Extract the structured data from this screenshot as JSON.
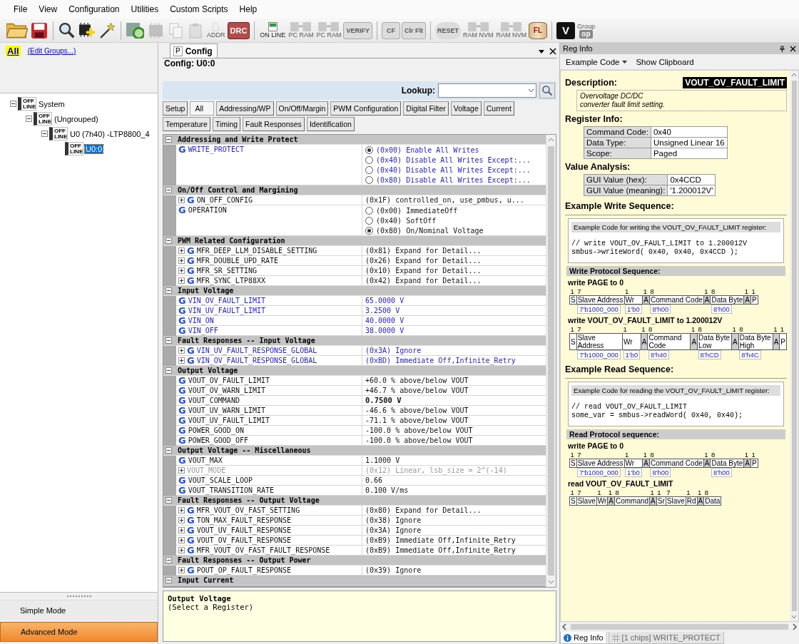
{
  "menu": [
    "File",
    "View",
    "Configuration",
    "Utilities",
    "Custom Scripts",
    "Help"
  ],
  "toolbar": [
    {
      "kind": "folder",
      "disabled": false
    },
    {
      "kind": "disk",
      "disabled": false
    },
    {
      "kind": "separator"
    },
    {
      "kind": "magnifier",
      "disabled": false
    },
    {
      "kind": "chip-plus",
      "disabled": false
    },
    {
      "kind": "wand",
      "disabled": false
    },
    {
      "kind": "separator"
    },
    {
      "kind": "chip-search",
      "disabled": false
    },
    {
      "kind": "chip",
      "disabled": true
    },
    {
      "kind": "pages",
      "disabled": true
    },
    {
      "kind": "clipboard",
      "disabled": true
    },
    {
      "kind": "document",
      "text": "ADDR",
      "disabled": true
    },
    {
      "kind": "red-badge",
      "text": "DRC",
      "disabled": false
    },
    {
      "kind": "separator"
    },
    {
      "kind": "online",
      "text": "ON LINE",
      "disabled": false
    },
    {
      "kind": "chip-arrow",
      "text": "PC RAM",
      "disabled": true
    },
    {
      "kind": "chip-arrow",
      "text": "PC RAM",
      "disabled": true
    },
    {
      "kind": "grey-badge",
      "text": "VERIFY",
      "disabled": true
    },
    {
      "kind": "separator"
    },
    {
      "kind": "grey-badge",
      "text": "CF",
      "disabled": true
    },
    {
      "kind": "grey-badge",
      "text": "Clr Flt",
      "disabled": true
    },
    {
      "kind": "separator"
    },
    {
      "kind": "round-badge",
      "text": "RESET",
      "disabled": true
    },
    {
      "kind": "chip-arrow",
      "text": "RAM NVM",
      "disabled": true
    },
    {
      "kind": "chip-arrow",
      "text": "RAM NVM",
      "disabled": true
    },
    {
      "kind": "cylinder",
      "text": "FL",
      "disabled": false
    },
    {
      "kind": "separator"
    },
    {
      "kind": "dark-badge",
      "text": "V",
      "disabled": false
    },
    {
      "kind": "group",
      "label": "Group",
      "text": "op",
      "disabled": true
    }
  ],
  "groups_panel": {
    "all_label": "All",
    "edit_link": "(Edit Groups...)"
  },
  "device_tree": [
    {
      "label": "System",
      "badge": "OFF LINE",
      "expanded": true,
      "selected": false,
      "children": [
        {
          "label": "(Ungrouped)",
          "badge": "OFF LINE",
          "expanded": true,
          "selected": false,
          "children": [
            {
              "label": "U0 (7h40) -LTP8800_4",
              "badge": "OFF LINE",
              "expanded": true,
              "selected": false,
              "children": [
                {
                  "label": "U0:0",
                  "badge": "OFF LINE",
                  "selected": true
                }
              ]
            }
          ]
        }
      ]
    }
  ],
  "mode_buttons": [
    {
      "label": "Simple Mode",
      "selected": false
    },
    {
      "label": "Advanced Mode",
      "selected": true
    }
  ],
  "config_panel": {
    "tabs": [
      {
        "pin": "P",
        "label": "Config",
        "selected": true
      }
    ],
    "title": "Config: U0:0",
    "lookup": {
      "label": "Lookup:"
    },
    "filters": [
      {
        "label": "Setup",
        "selected": false
      },
      {
        "label": "All",
        "selected": true
      },
      {
        "label": "Addressing/WP",
        "selected": false
      },
      {
        "label": "On/Off/Margin",
        "selected": false
      },
      {
        "label": "PWM Configuration",
        "selected": false
      },
      {
        "label": "Digital Filter",
        "selected": false
      },
      {
        "label": "Voltage",
        "selected": false
      },
      {
        "label": "Current",
        "selected": false
      },
      {
        "label": "Temperature",
        "selected": false
      },
      {
        "label": "Timing",
        "selected": false
      },
      {
        "label": "Fault Responses",
        "selected": false
      },
      {
        "label": "Identification",
        "selected": false
      }
    ],
    "groups": [
      {
        "title": "Addressing and Write Protect",
        "expanded": true,
        "rows": [
          {
            "kind": "options",
            "badge": "G",
            "name": "WRITE_PROTECT",
            "modified": true,
            "options": [
              {
                "label": "(0x00) Enable All Writes",
                "selected": true
              },
              {
                "label": "(0x40) Disable All Writes Except:...",
                "selected": false
              },
              {
                "label": "(0x40) Disable All Writes Except:...",
                "selected": false
              },
              {
                "label": "(0x80) Disable All Writes Except:...",
                "selected": false
              }
            ]
          }
        ]
      },
      {
        "title": "On/Off Control and Margining",
        "expanded": true,
        "rows": [
          {
            "kind": "expandable",
            "badge": "G",
            "name": "ON_OFF_CONFIG",
            "modified": false,
            "value": "(0x1F)  controlled_on, use_pmbus, u..."
          },
          {
            "kind": "options",
            "badge": "G",
            "name": "OPERATION",
            "modified": false,
            "options": [
              {
                "label": "(0x00) ImmediateOff",
                "selected": false
              },
              {
                "label": "(0x40) SoftOff",
                "selected": false
              },
              {
                "label": "(0x80) On/Nominal Voltage",
                "selected": true
              }
            ]
          }
        ]
      },
      {
        "title": "PWM Related Configuration",
        "expanded": true,
        "rows": [
          {
            "kind": "expandable",
            "badge": "G",
            "name": "MFR_DEEP_LLM_DISABLE_SETTING",
            "modified": false,
            "value": "(0x81) Expand for Detail..."
          },
          {
            "kind": "expandable",
            "badge": "G",
            "name": "MFR_DOUBLE_UPD_RATE",
            "modified": false,
            "value": "(0x26) Expand for Detail..."
          },
          {
            "kind": "expandable",
            "badge": "G",
            "name": "MFR_SR_SETTING",
            "modified": false,
            "value": "(0x10) Expand for Detail..."
          },
          {
            "kind": "expandable",
            "badge": "G",
            "name": "MFR_SYNC_LTP88XX",
            "modified": false,
            "value": "(0x42) Expand for Detail..."
          }
        ]
      },
      {
        "title": "Input Voltage",
        "expanded": true,
        "rows": [
          {
            "kind": "value",
            "badge": "G",
            "name": "VIN_OV_FAULT_LIMIT",
            "modified": true,
            "value": "65.0000 V"
          },
          {
            "kind": "value",
            "badge": "G",
            "name": "VIN_UV_FAULT_LIMIT",
            "modified": true,
            "value": "3.2500 V"
          },
          {
            "kind": "value",
            "badge": "G",
            "name": "VIN_ON",
            "modified": true,
            "value": "40.0000 V"
          },
          {
            "kind": "value",
            "badge": "G",
            "name": "VIN_OFF",
            "modified": true,
            "value": "38.0000 V"
          }
        ]
      },
      {
        "title": "Fault Responses -- Input Voltage",
        "expanded": true,
        "rows": [
          {
            "kind": "expandable",
            "badge": "G",
            "name": "VIN_UV_FAULT_RESPONSE_GLOBAL",
            "modified": true,
            "value": "(0x3A) Ignore"
          },
          {
            "kind": "expandable",
            "badge": "G",
            "name": "VIN_OV_FAULT_RESPONSE_GLOBAL",
            "modified": true,
            "value": "(0xBD) Immediate Off,Infinite_Retry"
          }
        ]
      },
      {
        "title": "Output Voltage",
        "expanded": true,
        "rows": [
          {
            "kind": "value",
            "badge": "G",
            "name": "VOUT_OV_FAULT_LIMIT",
            "modified": false,
            "value": "+60.0 % above/below VOUT"
          },
          {
            "kind": "value",
            "badge": "G",
            "name": "VOUT_OV_WARN_LIMIT",
            "modified": false,
            "value": "+46.7 % above/below VOUT"
          },
          {
            "kind": "emphasized",
            "badge": "G",
            "name": "VOUT_COMMAND",
            "modified": false,
            "value": "0.7500 V"
          },
          {
            "kind": "value",
            "badge": "G",
            "name": "VOUT_UV_WARN_LIMIT",
            "modified": false,
            "value": "-46.6 % above/below VOUT"
          },
          {
            "kind": "value",
            "badge": "G",
            "name": "VOUT_UV_FAULT_LIMIT",
            "modified": false,
            "value": "-71.1 % above/below VOUT"
          },
          {
            "kind": "value",
            "badge": "G",
            "name": "POWER_GOOD_ON",
            "modified": false,
            "value": "-100.0 % above/below VOUT"
          },
          {
            "kind": "value",
            "badge": "G",
            "name": "POWER_GOOD_OFF",
            "modified": false,
            "value": "-100.0 % above/below VOUT"
          }
        ]
      },
      {
        "title": "Output Voltage -- Miscellaneous",
        "expanded": true,
        "rows": [
          {
            "kind": "value",
            "badge": "G",
            "name": "VOUT_MAX",
            "modified": false,
            "value": "1.1000 V"
          },
          {
            "kind": "readonly",
            "name": "VOUT_MODE",
            "modified": false,
            "value": "(0x12) Linear, lsb_size = 2^(-14)"
          },
          {
            "kind": "value",
            "badge": "G",
            "name": "VOUT_SCALE_LOOP",
            "modified": false,
            "value": "0.66"
          },
          {
            "kind": "value",
            "badge": "G",
            "name": "VOUT_TRANSITION_RATE",
            "modified": false,
            "value": "0.100 V/ms"
          }
        ]
      },
      {
        "title": "Fault Responses -- Output Voltage",
        "expanded": true,
        "rows": [
          {
            "kind": "expandable",
            "badge": "G",
            "name": "MFR_VOUT_OV_FAST_SETTING",
            "modified": false,
            "value": "(0x80) Expand for Detail..."
          },
          {
            "kind": "expandable",
            "badge": "G",
            "name": "TON_MAX_FAULT_RESPONSE",
            "modified": false,
            "value": "(0x38) Ignore"
          },
          {
            "kind": "expandable",
            "badge": "G",
            "name": "VOUT_UV_FAULT_RESPONSE",
            "modified": false,
            "value": "(0x3A) Ignore"
          },
          {
            "kind": "expandable",
            "badge": "G",
            "name": "VOUT_OV_FAULT_RESPONSE",
            "modified": false,
            "value": "(0xB9) Immediate Off,Infinite_Retry"
          },
          {
            "kind": "expandable",
            "badge": "G",
            "name": "MFR_VOUT_OV_FAST_FAULT_RESPONSE",
            "modified": false,
            "value": "(0xB9) Immediate Off,Infinite_Retry"
          }
        ]
      },
      {
        "title": "Fault Responses -- Output Power",
        "expanded": true,
        "rows": [
          {
            "kind": "expandable",
            "badge": "G",
            "name": "POUT_OP_FAULT_RESPONSE",
            "modified": false,
            "value": "(0x39) Ignore"
          }
        ]
      },
      {
        "title": "Input Current",
        "expanded": true
      }
    ],
    "description": {
      "title": "Output Voltage",
      "text": "(Select a Register)"
    }
  },
  "reg_info": {
    "title": "Reg Info",
    "toolbar": [
      {
        "label": "Example Code",
        "dropdown": true
      },
      {
        "label": "Show Clipboard",
        "dropdown": false
      }
    ],
    "description": {
      "label": "Description:",
      "register": "VOUT_OV_FAULT_LIMIT",
      "lines": [
        "Overvoltage DC/DC",
        "converter fault limit setting."
      ]
    },
    "register_info": {
      "heading": "Register Info:",
      "rows": [
        {
          "label": "Command Code:",
          "value": "0x40"
        },
        {
          "label": "Data Type:",
          "value": "Unsigned Linear 16"
        },
        {
          "label": "Scope:",
          "value": "Paged"
        }
      ]
    },
    "value_analysis": {
      "heading": "Value Analysis:",
      "rows": [
        {
          "label": "GUI Value (hex):",
          "value": "0x4CCD"
        },
        {
          "label": "GUI Value (meaning):",
          "value": "'1.200012V'"
        }
      ]
    },
    "sequences": [
      {
        "heading": "Example Write Sequence:",
        "code_caption": "Example Code for writing the VOUT_OV_FAULT_LIMIT register:",
        "code": [
          "// write VOUT_OV_FAULT_LIMIT to 1.200012V",
          "smbus->writeWord( 0x40, 0x40, 0x4CCD );"
        ],
        "protocol_heading": "Write Protocol Sequence:",
        "frames": [
          {
            "title": "write PAGE to 0",
            "fields": [
              {
                "bits": "1",
                "label": "S",
                "kind": "plain"
              },
              {
                "bits": "7",
                "label": "Slave Address",
                "kind": "plain",
                "value": "7'b1000_000"
              },
              {
                "bits": "1",
                "label": "Wr",
                "kind": "plain",
                "value": "1'b0"
              },
              {
                "bits": "1",
                "label": "A",
                "kind": "ack"
              },
              {
                "bits": "8",
                "label": "Command Code",
                "kind": "plain",
                "value": "8'h00"
              },
              {
                "bits": "1",
                "label": "A",
                "kind": "ack"
              },
              {
                "bits": "8",
                "label": "Data Byte",
                "kind": "plain",
                "value": "8'h00"
              },
              {
                "bits": "1",
                "label": "A",
                "kind": "ack"
              },
              {
                "bits": "1",
                "label": "P",
                "kind": "plain"
              }
            ]
          },
          {
            "title": "write VOUT_OV_FAULT_LIMIT to 1.200012V",
            "fields": [
              {
                "bits": "1",
                "label": "S",
                "kind": "plain"
              },
              {
                "bits": "7",
                "label": "Slave Address",
                "kind": "plain",
                "value": "7'b1000_000"
              },
              {
                "bits": "1",
                "label": "Wr",
                "kind": "plain",
                "value": "1'b0"
              },
              {
                "bits": "1",
                "label": "A",
                "kind": "ack"
              },
              {
                "bits": "8",
                "label": "Command Code",
                "kind": "plain",
                "value": "8'h40"
              },
              {
                "bits": "1",
                "label": "A",
                "kind": "ack"
              },
              {
                "bits": "8",
                "label": "Data Byte Low",
                "kind": "plain",
                "value": "8'hCD"
              },
              {
                "bits": "1",
                "label": "A",
                "kind": "ack"
              },
              {
                "bits": "8",
                "label": "Data Byte High",
                "kind": "plain",
                "value": "8'h4C"
              },
              {
                "bits": "1",
                "label": "A",
                "kind": "ack"
              },
              {
                "bits": "1",
                "label": "P",
                "kind": "plain"
              }
            ]
          }
        ]
      },
      {
        "heading": "Example Read Sequence:",
        "code_caption": "Example Code for reading the VOUT_OV_FAULT_LIMIT register:",
        "code": [
          "// read VOUT_OV_FAULT_LIMIT",
          "some_var = smbus->readWord( 0x40, 0x40);"
        ],
        "protocol_heading": "Read Protocol sequence:",
        "frames": [
          {
            "title": "write PAGE to 0",
            "fields": [
              {
                "bits": "1",
                "label": "S",
                "kind": "plain"
              },
              {
                "bits": "7",
                "label": "Slave Address",
                "kind": "plain",
                "value": "7'b1000_000"
              },
              {
                "bits": "1",
                "label": "Wr",
                "kind": "plain",
                "value": "1'b0"
              },
              {
                "bits": "1",
                "label": "A",
                "kind": "ack"
              },
              {
                "bits": "8",
                "label": "Command Code",
                "kind": "plain",
                "value": "8'h00"
              },
              {
                "bits": "1",
                "label": "A",
                "kind": "ack"
              },
              {
                "bits": "8",
                "label": "Data Byte",
                "kind": "plain",
                "value": "8'h00"
              },
              {
                "bits": "1",
                "label": "A",
                "kind": "ack"
              },
              {
                "bits": "1",
                "label": "P",
                "kind": "plain"
              }
            ]
          },
          {
            "title": "read VOUT_OV_FAULT_LIMIT",
            "fields": [
              {
                "bits": "1",
                "label": "S",
                "kind": "plain"
              },
              {
                "bits": "7",
                "label": "Slave",
                "kind": "plain"
              },
              {
                "bits": "1",
                "label": "Wr",
                "kind": "plain"
              },
              {
                "bits": "1",
                "label": "A",
                "kind": "ack"
              },
              {
                "bits": "8",
                "label": "Command",
                "kind": "plain"
              },
              {
                "bits": "1",
                "label": "A",
                "kind": "ack"
              },
              {
                "bits": "1",
                "label": "Sr",
                "kind": "plain"
              },
              {
                "bits": "7",
                "label": "Slave",
                "kind": "plain"
              },
              {
                "bits": "1",
                "label": "Rd",
                "kind": "plain"
              },
              {
                "bits": "1",
                "label": "A",
                "kind": "ack"
              },
              {
                "bits": "8",
                "label": "Data",
                "kind": "plain"
              }
            ]
          }
        ]
      }
    ],
    "tabs": [
      {
        "label": "Reg Info",
        "kind": "info",
        "selected": true
      },
      {
        "label": "[1 chips] WRITE_PROTECT",
        "kind": "grid",
        "selected": false
      }
    ]
  }
}
